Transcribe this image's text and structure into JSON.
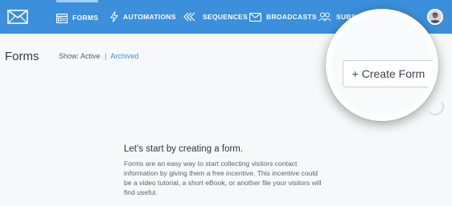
{
  "nav": {
    "items": [
      {
        "label": "FORMS",
        "icon": "form-icon",
        "active": true
      },
      {
        "label": "AUTOMATIONS",
        "icon": "lightning-icon",
        "active": false
      },
      {
        "label": "SEQUENCES",
        "icon": "sequence-icon",
        "active": false
      },
      {
        "label": "BROADCASTS",
        "icon": "mail-icon",
        "active": false
      },
      {
        "label": "SUBSC",
        "icon": "users-icon",
        "active": false
      }
    ],
    "brand_icon": "envelope-logo-icon",
    "avatar_icon": "user-avatar"
  },
  "page": {
    "title": "Forms",
    "show_label": "Show:",
    "show_active": "Active",
    "show_separator": "|",
    "show_archived": "Archived"
  },
  "actions": {
    "create_form_label": "+ Create Form"
  },
  "empty_state": {
    "heading": "Let’s start by creating a form.",
    "body": "Forms are an easy way to start collecting visitors contact information by giving them a free incentive. This incentive could be a video tutorial, a short eBook, or another file your visitors will find useful."
  },
  "colors": {
    "nav_background": "#3b8fdb",
    "link": "#3b8fdb",
    "page_background": "#f7f8fa"
  }
}
